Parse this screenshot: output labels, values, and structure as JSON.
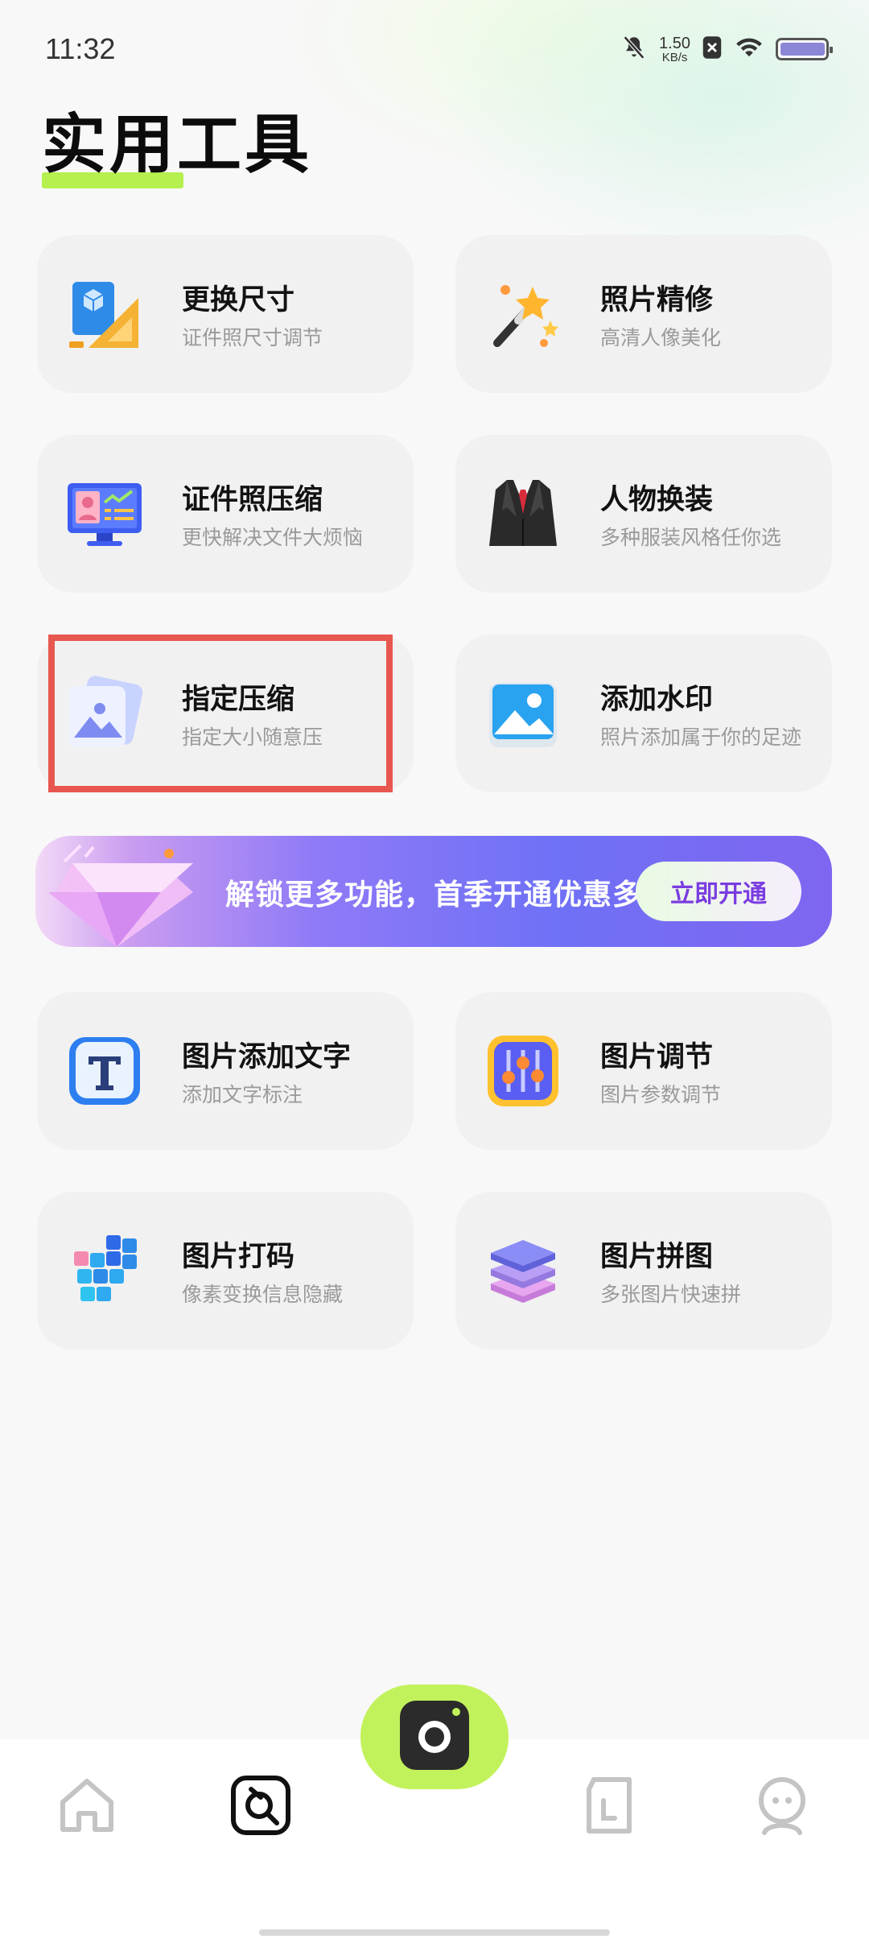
{
  "status_bar": {
    "time": "11:32",
    "net_speed_value": "1.50",
    "net_speed_unit": "KB/s",
    "icons": [
      "bell-muted-icon",
      "sim-blocked-icon",
      "wifi-icon",
      "battery-icon"
    ]
  },
  "page": {
    "title": "实用工具"
  },
  "tools": [
    {
      "name": "更换尺寸",
      "desc": "证件照尺寸调节",
      "icon": "resize-icon"
    },
    {
      "name": "照片精修",
      "desc": "高清人像美化",
      "icon": "magic-wand-icon"
    },
    {
      "name": "证件照压缩",
      "desc": "更快解决文件大烦恼",
      "icon": "monitor-id-icon"
    },
    {
      "name": "人物换装",
      "desc": "多种服装风格任你选",
      "icon": "suit-icon"
    },
    {
      "name": "指定压缩",
      "desc": "指定大小随意压",
      "icon": "image-stack-icon"
    },
    {
      "name": "添加水印",
      "desc": "照片添加属于你的足迹",
      "icon": "picture-icon"
    },
    {
      "name": "图片添加文字",
      "desc": "添加文字标注",
      "icon": "text-t-icon"
    },
    {
      "name": "图片调节",
      "desc": "图片参数调节",
      "icon": "sliders-icon"
    },
    {
      "name": "图片打码",
      "desc": "像素变换信息隐藏",
      "icon": "pixel-cubes-icon"
    },
    {
      "name": "图片拼图",
      "desc": "多张图片快速拼",
      "icon": "layers-icon"
    }
  ],
  "promo": {
    "text": "解锁更多功能，首季开通优惠多多",
    "button": "立即开通"
  },
  "bottom_nav": {
    "items": [
      "home-icon",
      "tools-icon",
      "camera-icon",
      "album-icon",
      "profile-icon"
    ],
    "active": "tools-icon"
  },
  "colors": {
    "accent": "#b5f04e",
    "highlight": "#e8574f",
    "promo_button_text": "#7a3de0"
  }
}
